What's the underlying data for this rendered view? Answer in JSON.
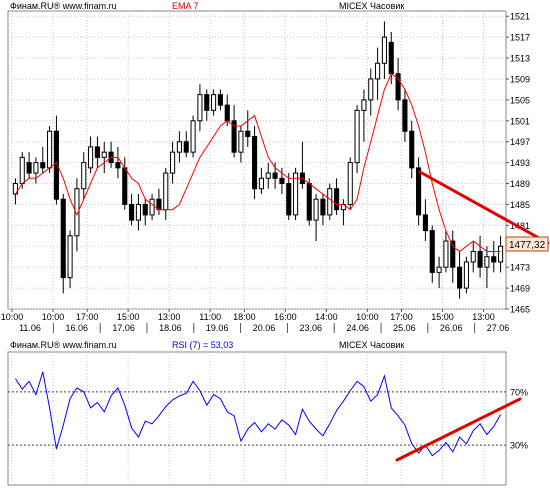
{
  "price_panel": {
    "source_label": "Финам.RU® www.finam.ru",
    "indicator_label": "EMA 7",
    "instrument_label": "MICEX Часовик",
    "last_price_label": "1477,32"
  },
  "rsi_panel": {
    "source_label": "Финам.RU® www.finam.ru",
    "indicator_label": "RSI (7) = 53,03",
    "instrument_label": "MICEX Часовик"
  },
  "colors": {
    "up_candle": "#ffffff",
    "down_candle": "#000000",
    "ema_line": "#ff0000",
    "rsi_line": "#0000ff",
    "trendline": "#e00000",
    "grid": "#c8c8c8"
  },
  "chart_data": [
    {
      "type": "candlestick",
      "instrument": "MICEX Часовик",
      "ylim": [
        1465,
        1522
      ],
      "y_ticks": [
        1465,
        1469,
        1473,
        1477,
        1481,
        1485,
        1489,
        1493,
        1497,
        1501,
        1505,
        1509,
        1513,
        1517,
        1521
      ],
      "x_tick_labels": [
        "10:00",
        "10:00",
        "17:00",
        "15:00",
        "13:00",
        "11:00",
        "18:00",
        "16:00",
        "14:00",
        "10:00",
        "17:00",
        "15:00",
        "13:00"
      ],
      "date_labels": [
        "11.06",
        "16.06",
        "17.06",
        "18.06",
        "19.06",
        "20.06",
        "23.06",
        "24.06",
        "25.06",
        "26.06",
        "27.06"
      ],
      "grid": true,
      "series": [
        {
          "name": "EMA 7",
          "values": [
            1487,
            1489,
            1490,
            1490,
            1491,
            1492,
            1493,
            1490,
            1486,
            1483,
            1486,
            1489,
            1492,
            1493,
            1494,
            1494,
            1492,
            1490,
            1489,
            1486,
            1485,
            1484,
            1484,
            1484,
            1485,
            1488,
            1491,
            1494,
            1496,
            1498,
            1500,
            1501,
            1500,
            1500,
            1501,
            1502,
            1498,
            1494,
            1492,
            1491,
            1490,
            1490,
            1490,
            1489,
            1488,
            1487,
            1486,
            1485,
            1485,
            1484,
            1486,
            1492,
            1497,
            1502,
            1507,
            1510,
            1509,
            1507,
            1504,
            1500,
            1495,
            1489,
            1484,
            1480,
            1477,
            1476,
            1477,
            1478,
            1477,
            1476,
            1476,
            1476
          ]
        }
      ],
      "candles": [
        {
          "o": 1487,
          "h": 1490,
          "l": 1485,
          "c": 1489
        },
        {
          "o": 1489,
          "h": 1495,
          "l": 1488,
          "c": 1494
        },
        {
          "o": 1493,
          "h": 1495,
          "l": 1490,
          "c": 1491
        },
        {
          "o": 1491,
          "h": 1494,
          "l": 1489,
          "c": 1493
        },
        {
          "o": 1493,
          "h": 1496,
          "l": 1491,
          "c": 1492
        },
        {
          "o": 1492,
          "h": 1500,
          "l": 1491,
          "c": 1499
        },
        {
          "o": 1499,
          "h": 1502,
          "l": 1485,
          "c": 1486
        },
        {
          "o": 1486,
          "h": 1487,
          "l": 1468,
          "c": 1471
        },
        {
          "o": 1471,
          "h": 1480,
          "l": 1469,
          "c": 1479
        },
        {
          "o": 1479,
          "h": 1490,
          "l": 1476,
          "c": 1488
        },
        {
          "o": 1488,
          "h": 1495,
          "l": 1486,
          "c": 1493
        },
        {
          "o": 1492,
          "h": 1498,
          "l": 1491,
          "c": 1496
        },
        {
          "o": 1496,
          "h": 1498,
          "l": 1492,
          "c": 1494
        },
        {
          "o": 1494,
          "h": 1497,
          "l": 1491,
          "c": 1495
        },
        {
          "o": 1495,
          "h": 1497,
          "l": 1492,
          "c": 1493
        },
        {
          "o": 1493,
          "h": 1496,
          "l": 1490,
          "c": 1492
        },
        {
          "o": 1492,
          "h": 1494,
          "l": 1484,
          "c": 1485
        },
        {
          "o": 1485,
          "h": 1487,
          "l": 1481,
          "c": 1482
        },
        {
          "o": 1482,
          "h": 1487,
          "l": 1480,
          "c": 1485
        },
        {
          "o": 1485,
          "h": 1486,
          "l": 1481,
          "c": 1483
        },
        {
          "o": 1483,
          "h": 1487,
          "l": 1482,
          "c": 1486
        },
        {
          "o": 1486,
          "h": 1488,
          "l": 1483,
          "c": 1484
        },
        {
          "o": 1484,
          "h": 1492,
          "l": 1482,
          "c": 1491
        },
        {
          "o": 1491,
          "h": 1497,
          "l": 1489,
          "c": 1495
        },
        {
          "o": 1495,
          "h": 1499,
          "l": 1493,
          "c": 1497
        },
        {
          "o": 1497,
          "h": 1499,
          "l": 1494,
          "c": 1495
        },
        {
          "o": 1495,
          "h": 1502,
          "l": 1494,
          "c": 1501
        },
        {
          "o": 1501,
          "h": 1508,
          "l": 1499,
          "c": 1506
        },
        {
          "o": 1506,
          "h": 1507,
          "l": 1501,
          "c": 1503
        },
        {
          "o": 1503,
          "h": 1507,
          "l": 1502,
          "c": 1506
        },
        {
          "o": 1506,
          "h": 1507,
          "l": 1503,
          "c": 1504
        },
        {
          "o": 1504,
          "h": 1506,
          "l": 1500,
          "c": 1501
        },
        {
          "o": 1501,
          "h": 1504,
          "l": 1494,
          "c": 1495
        },
        {
          "o": 1495,
          "h": 1500,
          "l": 1493,
          "c": 1499
        },
        {
          "o": 1499,
          "h": 1503,
          "l": 1496,
          "c": 1498
        },
        {
          "o": 1498,
          "h": 1500,
          "l": 1486,
          "c": 1488
        },
        {
          "o": 1488,
          "h": 1492,
          "l": 1487,
          "c": 1490
        },
        {
          "o": 1490,
          "h": 1493,
          "l": 1488,
          "c": 1491
        },
        {
          "o": 1491,
          "h": 1493,
          "l": 1488,
          "c": 1490
        },
        {
          "o": 1490,
          "h": 1492,
          "l": 1487,
          "c": 1489
        },
        {
          "o": 1489,
          "h": 1491,
          "l": 1482,
          "c": 1483
        },
        {
          "o": 1483,
          "h": 1492,
          "l": 1482,
          "c": 1491
        },
        {
          "o": 1491,
          "h": 1497,
          "l": 1488,
          "c": 1489
        },
        {
          "o": 1489,
          "h": 1490,
          "l": 1481,
          "c": 1482
        },
        {
          "o": 1482,
          "h": 1487,
          "l": 1478,
          "c": 1486
        },
        {
          "o": 1486,
          "h": 1487,
          "l": 1481,
          "c": 1483
        },
        {
          "o": 1483,
          "h": 1489,
          "l": 1482,
          "c": 1488
        },
        {
          "o": 1488,
          "h": 1490,
          "l": 1483,
          "c": 1484
        },
        {
          "o": 1484,
          "h": 1486,
          "l": 1481,
          "c": 1485
        },
        {
          "o": 1485,
          "h": 1494,
          "l": 1484,
          "c": 1493
        },
        {
          "o": 1493,
          "h": 1504,
          "l": 1491,
          "c": 1503
        },
        {
          "o": 1503,
          "h": 1507,
          "l": 1497,
          "c": 1505
        },
        {
          "o": 1505,
          "h": 1511,
          "l": 1502,
          "c": 1509
        },
        {
          "o": 1509,
          "h": 1515,
          "l": 1505,
          "c": 1512
        },
        {
          "o": 1512,
          "h": 1520,
          "l": 1509,
          "c": 1517
        },
        {
          "o": 1516,
          "h": 1518,
          "l": 1508,
          "c": 1510
        },
        {
          "o": 1510,
          "h": 1513,
          "l": 1503,
          "c": 1505
        },
        {
          "o": 1505,
          "h": 1507,
          "l": 1497,
          "c": 1499
        },
        {
          "o": 1499,
          "h": 1501,
          "l": 1490,
          "c": 1492
        },
        {
          "o": 1492,
          "h": 1494,
          "l": 1481,
          "c": 1483
        },
        {
          "o": 1483,
          "h": 1486,
          "l": 1478,
          "c": 1480
        },
        {
          "o": 1480,
          "h": 1481,
          "l": 1470,
          "c": 1472
        },
        {
          "o": 1472,
          "h": 1475,
          "l": 1469,
          "c": 1473
        },
        {
          "o": 1473,
          "h": 1480,
          "l": 1472,
          "c": 1478
        },
        {
          "o": 1478,
          "h": 1480,
          "l": 1470,
          "c": 1473
        },
        {
          "o": 1473,
          "h": 1476,
          "l": 1467,
          "c": 1469
        },
        {
          "o": 1469,
          "h": 1475,
          "l": 1468,
          "c": 1474
        },
        {
          "o": 1474,
          "h": 1478,
          "l": 1472,
          "c": 1476
        },
        {
          "o": 1476,
          "h": 1479,
          "l": 1471,
          "c": 1473
        },
        {
          "o": 1473,
          "h": 1477,
          "l": 1469,
          "c": 1475
        },
        {
          "o": 1475,
          "h": 1478,
          "l": 1472,
          "c": 1474
        },
        {
          "o": 1474,
          "h": 1479,
          "l": 1472,
          "c": 1477
        }
      ],
      "last_value": 1477.32
    },
    {
      "type": "line",
      "title": "RSI (7) = 53,03",
      "ylim": [
        0,
        100
      ],
      "reference_levels": [
        {
          "label": "70%",
          "value": 70
        },
        {
          "label": "30%",
          "value": 30
        }
      ],
      "series": [
        {
          "name": "RSI (7)",
          "values": [
            80,
            72,
            78,
            68,
            85,
            58,
            27,
            45,
            65,
            73,
            70,
            58,
            62,
            55,
            67,
            73,
            60,
            43,
            36,
            48,
            46,
            52,
            59,
            64,
            67,
            69,
            78,
            71,
            60,
            68,
            65,
            55,
            52,
            33,
            42,
            47,
            40,
            46,
            42,
            49,
            45,
            38,
            57,
            48,
            42,
            37,
            46,
            56,
            63,
            71,
            78,
            74,
            63,
            68,
            82,
            58,
            52,
            45,
            31,
            24,
            30,
            22,
            26,
            32,
            25,
            36,
            31,
            41,
            46,
            38,
            44,
            53
          ]
        }
      ]
    }
  ]
}
